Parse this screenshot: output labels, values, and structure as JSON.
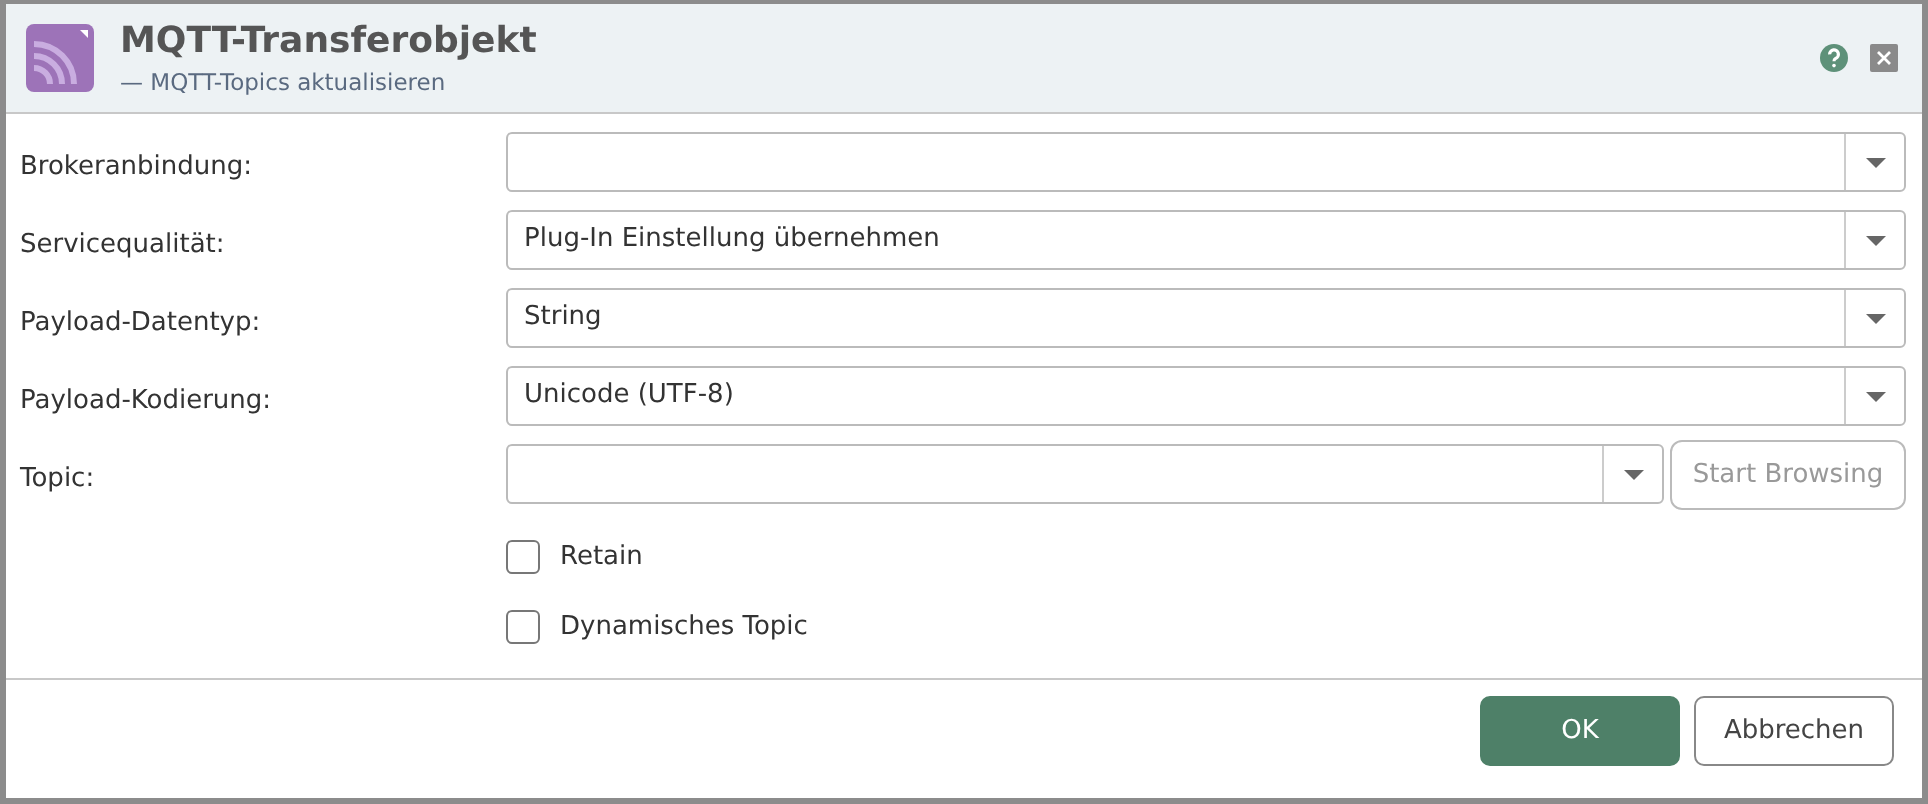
{
  "window": {
    "title": "MQTT-Transferobjekt",
    "subtitle": "— MQTT-Topics aktualisieren"
  },
  "fields": [
    {
      "kind": "select",
      "label": "Brokeranbindung:"
    },
    {
      "kind": "select",
      "label": "Servicequalität:",
      "value": "Plug-In Einstellung übernehmen"
    },
    {
      "kind": "select",
      "label": "Payload-Datentyp:",
      "value": "String"
    },
    {
      "kind": "select",
      "label": "Payload-Kodierung:",
      "value": "Unicode (UTF-8)"
    },
    {
      "kind": "combo_browse",
      "label": "Topic:",
      "button": {
        "label": "Start Browsing",
        "disabled": true
      }
    }
  ],
  "checkboxes": [
    {
      "label": "Retain",
      "checked": false
    },
    {
      "label": "Dynamisches Topic",
      "checked": false
    }
  ],
  "buttons": [
    {
      "label": "OK",
      "primary": true
    },
    {
      "label": "Abbrechen",
      "primary": false
    }
  ]
}
